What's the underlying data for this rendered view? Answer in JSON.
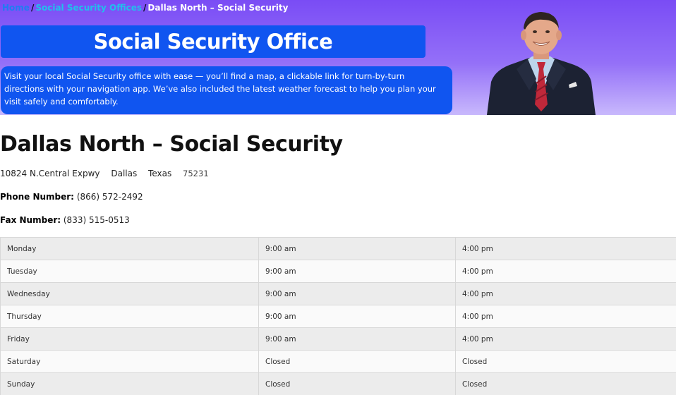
{
  "breadcrumb": {
    "home": "Home",
    "offices": "Social Security Offices",
    "separator": "/",
    "current": "Dallas North – Social Security"
  },
  "hero": {
    "title": "Social Security Office",
    "description": "Visit your local Social Security office with ease — you’ll find a map, a clickable link for turn-by-turn directions with your navigation app.  We’ve also included the latest weather forecast to help you plan your visit safely and comfortably.",
    "colors": {
      "gradient_top": "#7a4cf5",
      "box_blue": "#1055f0",
      "home_link": "#1e7df2",
      "offices_link": "#20c0ec"
    }
  },
  "office": {
    "name": "Dallas North – Social Security",
    "street": "10824 N.Central Expwy",
    "city": "Dallas",
    "state": "Texas",
    "zip": "75231",
    "phone_label": "Phone Number:",
    "phone": "(866) 572-2492",
    "fax_label": "Fax Number:",
    "fax": "(833) 515-0513"
  },
  "hours": [
    {
      "day": "Monday",
      "open": "9:00 am",
      "close": "4:00 pm"
    },
    {
      "day": "Tuesday",
      "open": "9:00 am",
      "close": "4:00 pm"
    },
    {
      "day": "Wednesday",
      "open": "9:00 am",
      "close": "4:00 pm"
    },
    {
      "day": "Thursday",
      "open": "9:00 am",
      "close": "4:00 pm"
    },
    {
      "day": "Friday",
      "open": "9:00 am",
      "close": "4:00 pm"
    },
    {
      "day": "Saturday",
      "open": "Closed",
      "close": "Closed"
    },
    {
      "day": "Sunday",
      "open": "Closed",
      "close": "Closed"
    }
  ]
}
